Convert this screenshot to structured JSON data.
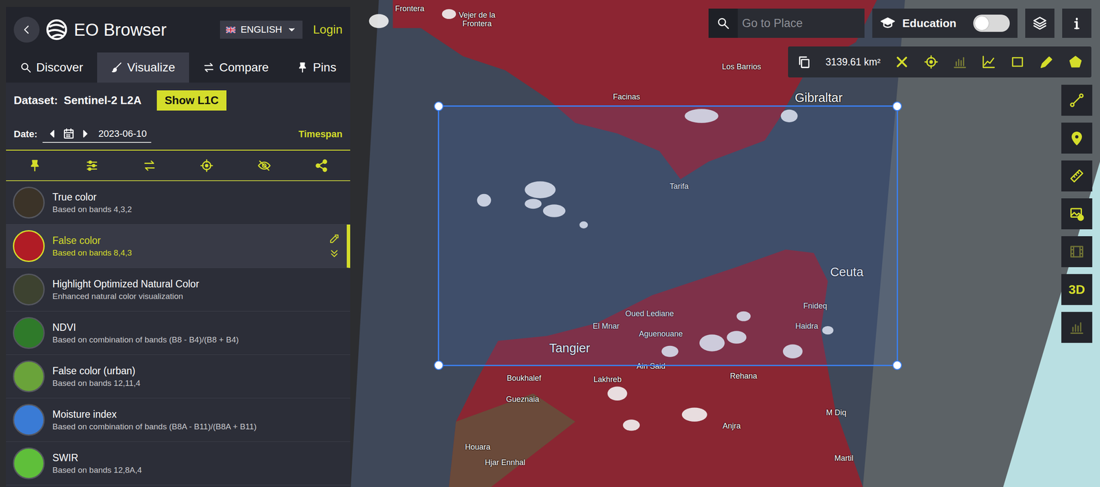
{
  "header": {
    "title": "EO Browser",
    "language": "ENGLISH",
    "login": "Login"
  },
  "tabs": [
    {
      "label": "Discover",
      "selected": false
    },
    {
      "label": "Visualize",
      "selected": true
    },
    {
      "label": "Compare",
      "selected": false
    },
    {
      "label": "Pins",
      "selected": false
    }
  ],
  "dataset": {
    "label": "Dataset:",
    "value": "Sentinel-2 L2A",
    "button": "Show L1C"
  },
  "date": {
    "label": "Date:",
    "value": "2023-06-10",
    "timespan": "Timespan"
  },
  "layers": [
    {
      "title": "True color",
      "subtitle": "Based on bands 4,3,2",
      "selected": false,
      "color": "#3b3328"
    },
    {
      "title": "False color",
      "subtitle": "Based on bands 8,4,3",
      "selected": true,
      "color": "#b01c25"
    },
    {
      "title": "Highlight Optimized Natural Color",
      "subtitle": "Enhanced natural color visualization",
      "selected": false,
      "color": "#3d4230"
    },
    {
      "title": "NDVI",
      "subtitle": "Based on combination of bands (B8 - B4)/(B8 + B4)",
      "selected": false,
      "color": "#2f7a2a"
    },
    {
      "title": "False color (urban)",
      "subtitle": "Based on bands 12,11,4",
      "selected": false,
      "color": "#6aa33a"
    },
    {
      "title": "Moisture index",
      "subtitle": "Based on combination of bands (B8A - B11)/(B8A + B11)",
      "selected": false,
      "color": "#3a7bd5"
    },
    {
      "title": "SWIR",
      "subtitle": "Based on bands 12,8A,4",
      "selected": false,
      "color": "#5fbf3a"
    }
  ],
  "search": {
    "placeholder": "Go to Place"
  },
  "education": {
    "label": "Education",
    "on": false
  },
  "measure": {
    "area": "3139.61 km²",
    "tools": [
      {
        "kind": "close",
        "disabled": false
      },
      {
        "kind": "center",
        "disabled": false
      },
      {
        "kind": "histogram",
        "disabled": true
      },
      {
        "kind": "chart",
        "disabled": false
      },
      {
        "kind": "rectangle",
        "disabled": false
      },
      {
        "kind": "pencil",
        "disabled": false
      },
      {
        "kind": "polygon",
        "disabled": false
      }
    ]
  },
  "side_tools": [
    {
      "kind": "path",
      "disabled": false
    },
    {
      "kind": "marker",
      "disabled": false
    },
    {
      "kind": "ruler",
      "disabled": false
    },
    {
      "kind": "image",
      "disabled": false
    },
    {
      "kind": "film",
      "disabled": true
    },
    {
      "kind": "label",
      "label": "3D",
      "disabled": false
    },
    {
      "kind": "stats",
      "disabled": true
    }
  ],
  "map_labels": [
    {
      "text": "Frontera",
      "kind": "town"
    },
    {
      "text": "Vejer de la Frontera",
      "kind": "town"
    },
    {
      "text": "Los Barrios",
      "kind": "town"
    },
    {
      "text": "Facinas",
      "kind": "town"
    },
    {
      "text": "Gibraltar",
      "kind": "city"
    },
    {
      "text": "Tarifa",
      "kind": "town"
    },
    {
      "text": "Ceuta",
      "kind": "city"
    },
    {
      "text": "Oued Lediane",
      "kind": "town"
    },
    {
      "text": "El Mnar",
      "kind": "town"
    },
    {
      "text": "Aguenouane",
      "kind": "town"
    },
    {
      "text": "Fnideq",
      "kind": "town"
    },
    {
      "text": "Haidra",
      "kind": "town"
    },
    {
      "text": "Tangier",
      "kind": "city"
    },
    {
      "text": "Ain Said",
      "kind": "town"
    },
    {
      "text": "Boukhalef",
      "kind": "town"
    },
    {
      "text": "Lakhreb",
      "kind": "town"
    },
    {
      "text": "Rehana",
      "kind": "town"
    },
    {
      "text": "Gueznaia",
      "kind": "town"
    },
    {
      "text": "M Diq",
      "kind": "town"
    },
    {
      "text": "Anjra",
      "kind": "town"
    },
    {
      "text": "Houara",
      "kind": "town"
    },
    {
      "text": "Hjar Ennhal",
      "kind": "town"
    },
    {
      "text": "Martil",
      "kind": "town"
    }
  ]
}
